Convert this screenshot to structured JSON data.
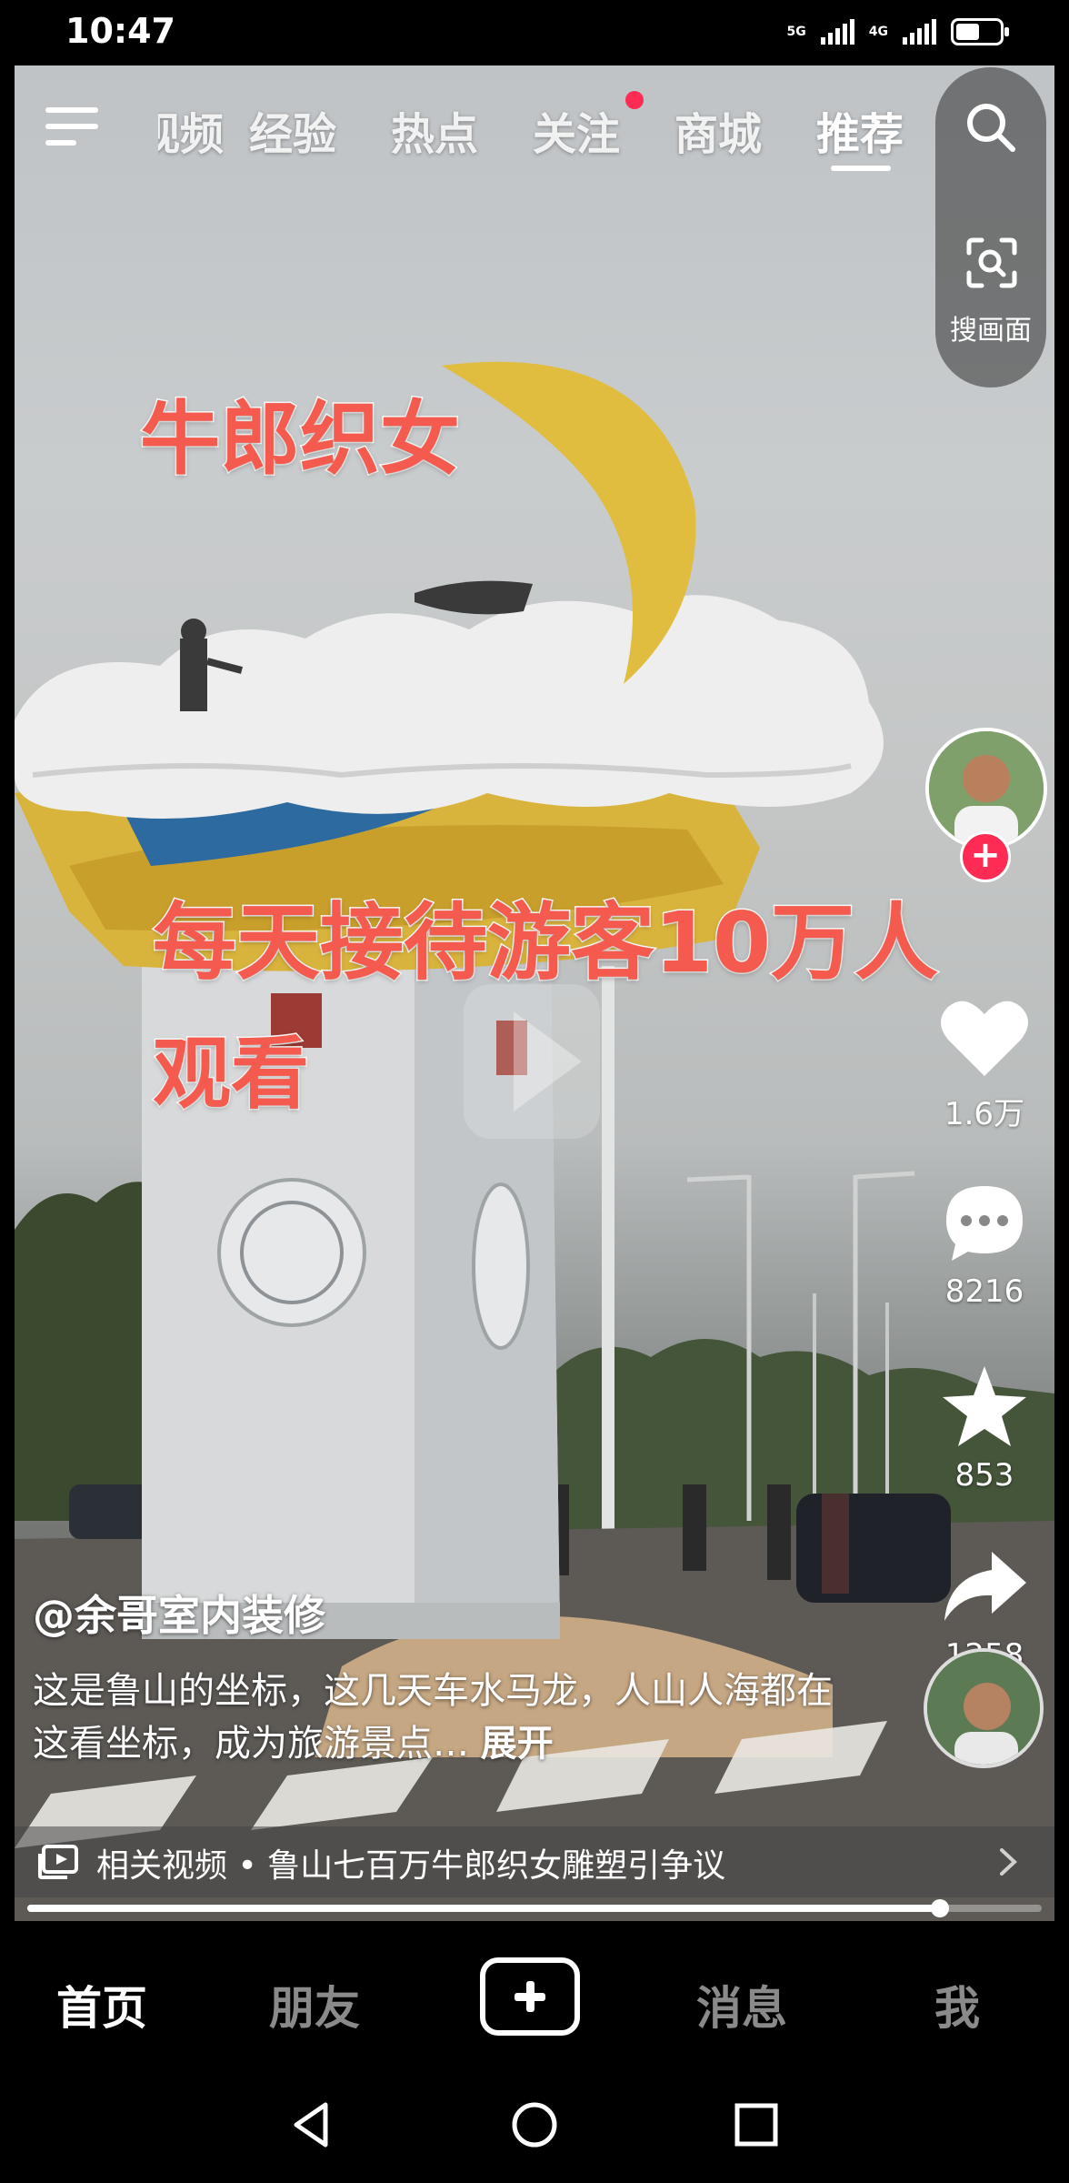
{
  "status_bar": {
    "time": "10:47",
    "signal_1": "5G",
    "signal_2": "4G",
    "battery_level": 0.6
  },
  "top_tabs": {
    "items": [
      {
        "label": "视频",
        "active": false
      },
      {
        "label": "经验",
        "active": false
      },
      {
        "label": "热点",
        "active": false
      },
      {
        "label": "关注",
        "active": false,
        "badge": true
      },
      {
        "label": "商城",
        "active": false
      },
      {
        "label": "推荐",
        "active": true
      }
    ],
    "scan_label": "搜画面"
  },
  "video": {
    "overlay_title": "牛郎织女",
    "overlay_line_1": "每天接待游客10万人",
    "overlay_line_2": "观看",
    "author": "@余哥室内装修",
    "caption": "这是鲁山的坐标，这几天车水马龙，人山人海都在这看坐标，成为旅游景点…",
    "expand_label": "展开",
    "related": "相关视频 • 鲁山七百万牛郎织女雕塑引争议",
    "progress": 0.9
  },
  "actions": {
    "likes": "1.6万",
    "comments": "8216",
    "favorites": "853",
    "shares": "1258"
  },
  "bottom_nav": {
    "home": "首页",
    "friends": "朋友",
    "messages": "消息",
    "me": "我"
  },
  "colors": {
    "accent": "#fe2c55",
    "overlay_text": "#f45b4e"
  }
}
